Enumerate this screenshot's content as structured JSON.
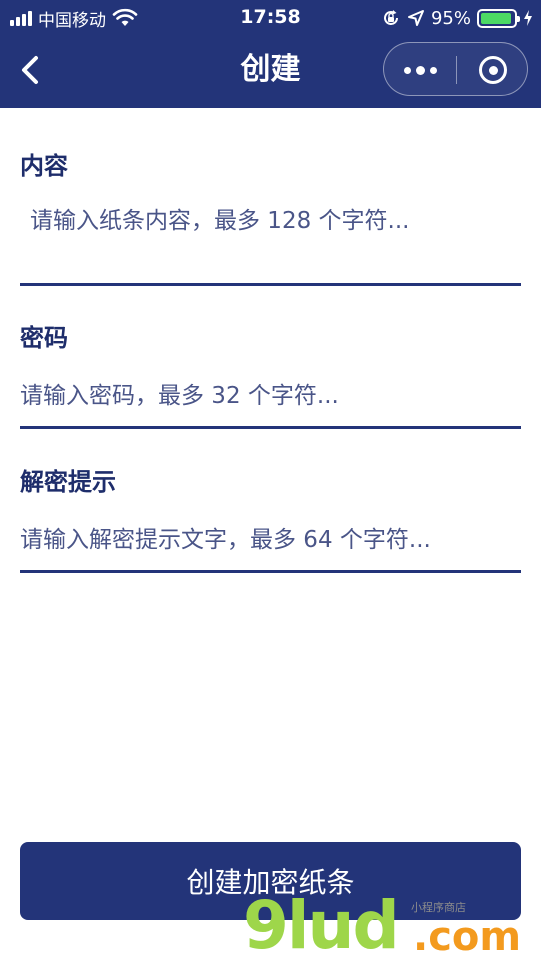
{
  "status_bar": {
    "carrier": "中国移动",
    "time": "17:58",
    "battery_percent": "95%",
    "battery_level": 0.95,
    "icons": [
      "signal-icon",
      "wifi-icon",
      "orientation-lock-icon",
      "location-icon",
      "battery-icon",
      "charging-icon"
    ]
  },
  "nav": {
    "title": "创建",
    "back_icon": "chevron-left-icon",
    "more_icon": "more-dots-icon",
    "close_icon": "target-close-icon"
  },
  "form": {
    "content": {
      "label": "内容",
      "placeholder": "请输入纸条内容，最多 128 个字符..."
    },
    "password": {
      "label": "密码",
      "placeholder": "请输入密码，最多 32 个字符..."
    },
    "hint": {
      "label": "解密提示",
      "placeholder": "请输入解密提示文字，最多 64 个字符..."
    }
  },
  "submit_label": "创建加密纸条",
  "watermark": {
    "logo": "9lud",
    "tld": ".com",
    "slogan": "小程序商店"
  },
  "colors": {
    "primary": "#233479",
    "text": "#1e2d6b",
    "battery": "#4cd964",
    "watermark_green": "#9ed64a",
    "watermark_orange": "#f39a1e"
  }
}
